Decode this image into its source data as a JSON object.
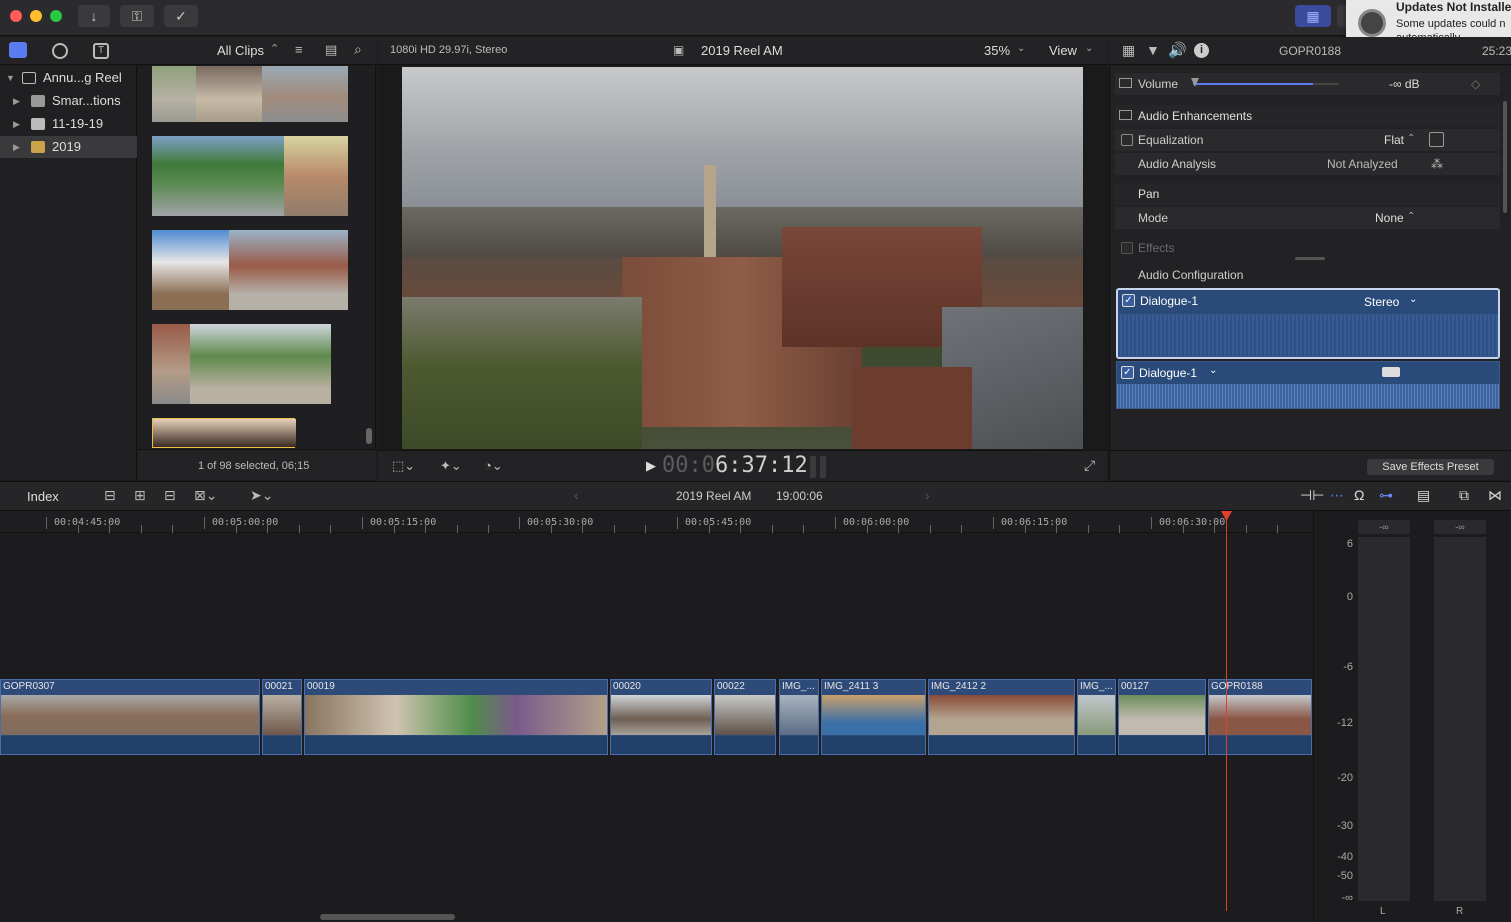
{
  "notification": {
    "title": "Updates Not Installe",
    "body1": "Some updates could n",
    "body2": "automatically."
  },
  "browser_header": {
    "filter_label": "All Clips",
    "status": "1 of 98 selected, 06;15"
  },
  "library": {
    "items": [
      {
        "label": "Annu...g Reel",
        "arrow": "▼"
      },
      {
        "label": "Smar...tions",
        "arrow": "▶"
      },
      {
        "label": "11-19-19",
        "arrow": "▶"
      },
      {
        "label": "2019",
        "arrow": "▶"
      }
    ]
  },
  "viewer": {
    "format": "1080i HD 29.97i, Stereo",
    "project_name": "2019 Reel AM",
    "zoom": "35%",
    "view_label": "View",
    "timecode_dim": "00:0",
    "timecode_bright": "6:37:12"
  },
  "inspector": {
    "clip_name": "GOPR0188",
    "clip_time": "25:23",
    "volume_label": "Volume",
    "volume_value": "-∞  dB",
    "audio_enhancements": "Audio Enhancements",
    "equalization_label": "Equalization",
    "equalization_value": "Flat",
    "audio_analysis_label": "Audio Analysis",
    "audio_analysis_value": "Not Analyzed",
    "pan_label": "Pan",
    "mode_label": "Mode",
    "mode_value": "None",
    "effects_label": "Effects",
    "audio_config_label": "Audio Configuration",
    "channel1_name": "Dialogue-1",
    "channel1_format": "Stereo",
    "channel2_name": "Dialogue-1",
    "save_preset": "Save Effects Preset"
  },
  "timeline_toolbar": {
    "index_label": "Index",
    "project_name": "2019 Reel AM",
    "duration": "19:00:06"
  },
  "ruler": [
    "00:04:45:00",
    "00:05:00:00",
    "00:05:15:00",
    "00:05:30:00",
    "00:05:45:00",
    "00:06:00:00",
    "00:06:15:00",
    "00:06:30:00"
  ],
  "clips": [
    "GOPR0307",
    "00021",
    "00019",
    "00020",
    "00022",
    "IMG_...",
    "IMG_2411 3",
    "IMG_2412 2",
    "IMG_...",
    "00127",
    "GOPR0188"
  ],
  "meters": {
    "scale": [
      "6",
      "0",
      "-6",
      "-12",
      "-20",
      "-30",
      "-40",
      "-50",
      "-∞"
    ],
    "peak_left": "-∞",
    "peak_right": "-∞",
    "left_label": "L",
    "right_label": "R"
  },
  "colors": {
    "accent": "#5b7cf0",
    "playhead": "#e0412f",
    "clip": "#2d4a78"
  }
}
